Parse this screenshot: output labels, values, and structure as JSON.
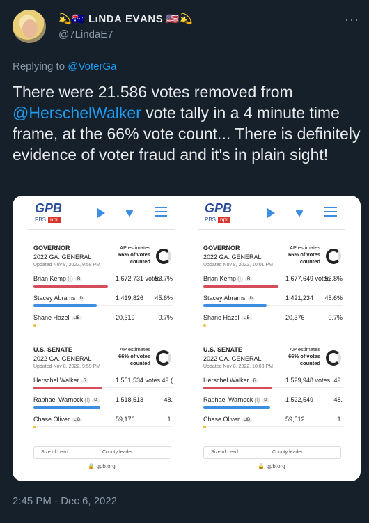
{
  "author": {
    "display_name": "💫🇦🇺 LιΝDΑ ΕVΑΝS 🇺🇸💫",
    "handle": "@7LindaE7"
  },
  "more_label": "···",
  "reply": {
    "prefix": "Replying to",
    "target": "@VoterGa"
  },
  "tweet": {
    "part1": "There were 21.586 votes removed from ",
    "mention": "@HerschelWalker",
    "part2": " vote tally in a 4 minute time frame, at the 66% vote count... There is definitely evidence of voter fraud and it's in plain sight!"
  },
  "timestamp": "2:45 PM · Dec 6, 2022",
  "colors": {
    "accent": "#1d9bf0",
    "bg": "#15202b",
    "muted": "#8b98a5",
    "rep": "#d54d5b",
    "dem": "#3d8ee0"
  },
  "screenshots": [
    {
      "logo": "GPB",
      "sub": "PBS",
      "npr": "npr",
      "races": [
        {
          "title": "GOVERNOR",
          "sub": "2022 GA. GENERAL",
          "updated": "Updated Nov 8, 2022, 9:58 PM",
          "ap": [
            "AP estimates",
            "66% of votes",
            "counted"
          ],
          "cands": [
            {
              "name": "Brian Kemp",
              "tag": "(i)",
              "party": "R",
              "votes": "1,672,731 votes",
              "pct": "53.7%",
              "share": 0.537,
              "color": "#d54d5b"
            },
            {
              "name": "Stacey Abrams",
              "tag": "",
              "party": "D",
              "votes": "1,419,826",
              "pct": "45.6%",
              "share": 0.456,
              "color": "#3d8ee0"
            },
            {
              "name": "Shane Hazel",
              "tag": "",
              "party": "LIB",
              "votes": "20,319",
              "pct": "0.7%",
              "share": 0.007,
              "color": "#f0c030"
            }
          ]
        },
        {
          "title": "U.S. SENATE",
          "sub": "2022 GA. GENERAL",
          "updated": "Updated Nov 8, 2022, 9:59 PM",
          "ap": [
            "AP estimates",
            "66% of votes",
            "counted"
          ],
          "cands": [
            {
              "name": "Herschel Walker",
              "tag": "",
              "party": "R",
              "votes": "1,551,534 votes",
              "pct": "49.(",
              "share": 0.49,
              "color": "#d54d5b"
            },
            {
              "name": "Raphael Warnock",
              "tag": "(i)",
              "party": "D",
              "votes": "1,518,513",
              "pct": "48.",
              "share": 0.48,
              "color": "#3d8ee0"
            },
            {
              "name": "Chase Oliver",
              "tag": "",
              "party": "LIB",
              "votes": "59,176",
              "pct": "1.",
              "share": 0.019,
              "color": "#f0c030"
            }
          ]
        }
      ],
      "lead_tabs": [
        "Size of Lead",
        "County leader"
      ],
      "url": "🔒 gpb.org"
    },
    {
      "logo": "GPB",
      "sub": "PBS",
      "npr": "npr",
      "races": [
        {
          "title": "GOVERNOR",
          "sub": "2022 GA. GENERAL",
          "updated": "Updated Nov 8, 2022, 10:01 PM",
          "ap": [
            "AP estimates",
            "66% of votes",
            "counted"
          ],
          "cands": [
            {
              "name": "Brian Kemp",
              "tag": "(i)",
              "party": "R",
              "votes": "1,677,649 votes",
              "pct": "53.8%",
              "share": 0.538,
              "color": "#d54d5b"
            },
            {
              "name": "Stacey Abrams",
              "tag": "",
              "party": "D",
              "votes": "1,421,234",
              "pct": "45.6%",
              "share": 0.456,
              "color": "#3d8ee0"
            },
            {
              "name": "Shane Hazel",
              "tag": "",
              "party": "LIB",
              "votes": "20,376",
              "pct": "0.7%",
              "share": 0.007,
              "color": "#f0c030"
            }
          ]
        },
        {
          "title": "U.S. SENATE",
          "sub": "2022 GA. GENERAL",
          "updated": "Updated Nov 8, 2022, 10:03 PM",
          "ap": [
            "AP estimates",
            "66% of votes",
            "counted"
          ],
          "cands": [
            {
              "name": "Herschel Walker",
              "tag": "",
              "party": "R",
              "votes": "1,529,948 votes",
              "pct": "49.",
              "share": 0.49,
              "color": "#d54d5b"
            },
            {
              "name": "Raphael Warnock",
              "tag": "(i)",
              "party": "D",
              "votes": "1,522,549",
              "pct": "48.",
              "share": 0.48,
              "color": "#3d8ee0"
            },
            {
              "name": "Chase Oliver",
              "tag": "",
              "party": "LIB",
              "votes": "59,512",
              "pct": "1.",
              "share": 0.019,
              "color": "#f0c030"
            }
          ]
        }
      ],
      "lead_tabs": [
        "Size of Lead",
        "County leader"
      ],
      "url": "🔒 gpb.org"
    }
  ]
}
